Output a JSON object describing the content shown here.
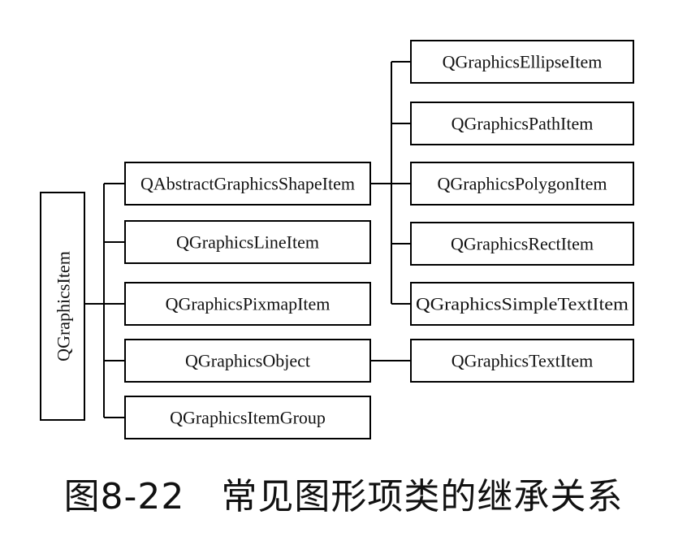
{
  "diagram": {
    "root": "QGraphicsItem",
    "level1": [
      "QAbstractGraphicsShapeItem",
      "QGraphicsLineItem",
      "QGraphicsPixmapItem",
      "QGraphicsObject",
      "QGraphicsItemGroup"
    ],
    "shape_children": [
      "QGraphicsEllipseItem",
      "QGraphicsPathItem",
      "QGraphicsPolygonItem",
      "QGraphicsRectItem",
      "QGraphicsSimpleTextItem"
    ],
    "object_children": [
      "QGraphicsTextItem"
    ]
  },
  "caption": "图8-22　常见图形项类的继承关系"
}
